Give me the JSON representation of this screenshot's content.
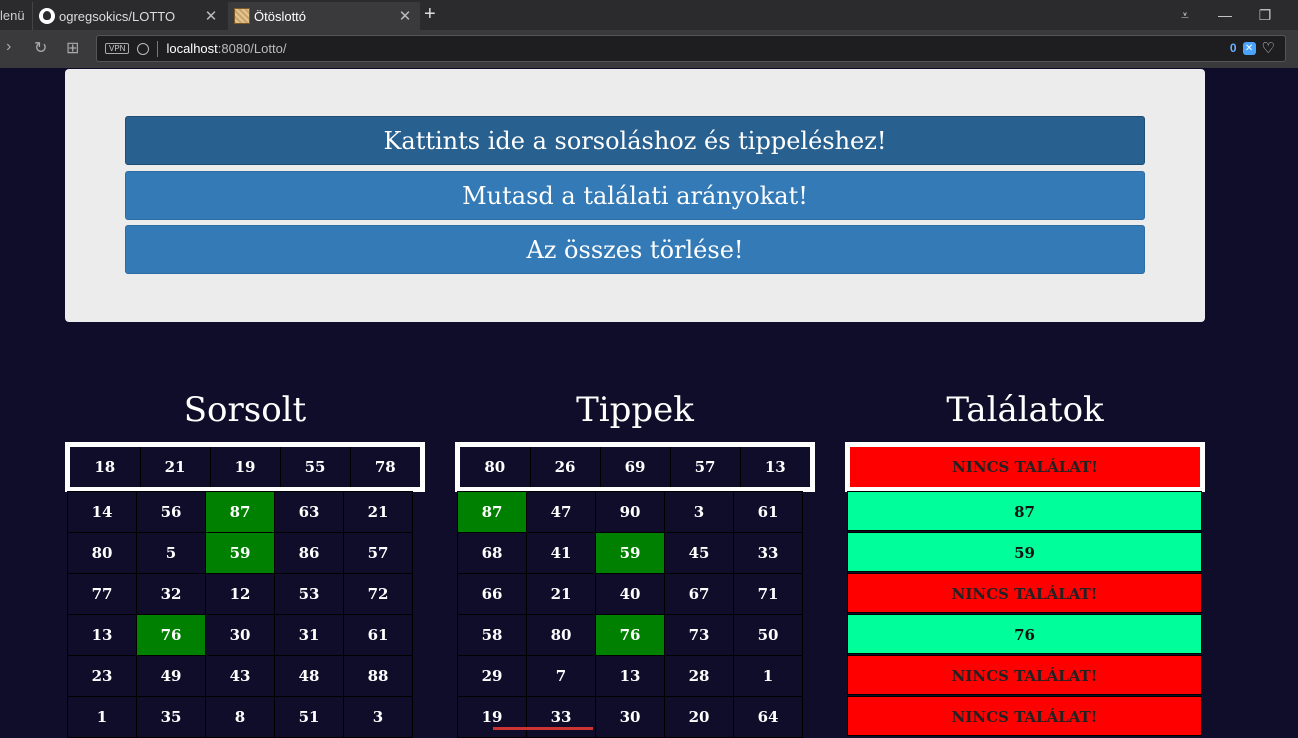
{
  "browser": {
    "menu_label": "lenü",
    "tabs": [
      {
        "title": "ogregsokics/LOTTO",
        "icon": "github-icon"
      },
      {
        "title": "Ötöslottó",
        "icon": "lotto-favicon-icon"
      }
    ],
    "url_host": "localhost",
    "url_rest": ":8080/Lotto/",
    "vpn_label": "VPN",
    "blocked_count": "0"
  },
  "buttons": {
    "draw": "Kattints ide a sorsoláshoz és tippeléshez!",
    "rates": "Mutasd a találati arányokat!",
    "clear": "Az összes törlése!"
  },
  "columns": {
    "drawn_title": "Sorsolt",
    "tips_title": "Tippek",
    "hits_title": "Találatok"
  },
  "drawn": {
    "first": [
      "18",
      "21",
      "19",
      "55",
      "78"
    ],
    "rows": [
      [
        "14",
        "56",
        "87",
        "63",
        "21"
      ],
      [
        "80",
        "5",
        "59",
        "86",
        "57"
      ],
      [
        "77",
        "32",
        "12",
        "53",
        "72"
      ],
      [
        "13",
        "76",
        "30",
        "31",
        "61"
      ],
      [
        "23",
        "49",
        "43",
        "48",
        "88"
      ],
      [
        "1",
        "35",
        "8",
        "51",
        "3"
      ]
    ],
    "hits": [
      [
        0,
        2
      ],
      [
        1,
        2
      ],
      [
        3,
        1
      ]
    ]
  },
  "tips": {
    "first": [
      "80",
      "26",
      "69",
      "57",
      "13"
    ],
    "rows": [
      [
        "87",
        "47",
        "90",
        "3",
        "61"
      ],
      [
        "68",
        "41",
        "59",
        "45",
        "33"
      ],
      [
        "66",
        "21",
        "40",
        "67",
        "71"
      ],
      [
        "58",
        "80",
        "76",
        "73",
        "50"
      ],
      [
        "29",
        "7",
        "13",
        "28",
        "1"
      ],
      [
        "19",
        "33",
        "30",
        "20",
        "64"
      ]
    ],
    "hits": [
      [
        0,
        0
      ],
      [
        1,
        2
      ],
      [
        3,
        2
      ]
    ]
  },
  "results": {
    "first": "NINCS TALÁLAT!",
    "rows": [
      {
        "text": "87",
        "hit": true
      },
      {
        "text": "59",
        "hit": true
      },
      {
        "text": "NINCS TALÁLAT!",
        "hit": false
      },
      {
        "text": "76",
        "hit": true
      },
      {
        "text": "NINCS TALÁLAT!",
        "hit": false
      },
      {
        "text": "NINCS TALÁLAT!",
        "hit": false
      }
    ]
  },
  "colors": {
    "page_bg": "#0f0d2a",
    "hit_green": "#008000",
    "win_green": "#00ff9b",
    "miss_red": "#ff0000",
    "button_blue": "#337ab7"
  }
}
